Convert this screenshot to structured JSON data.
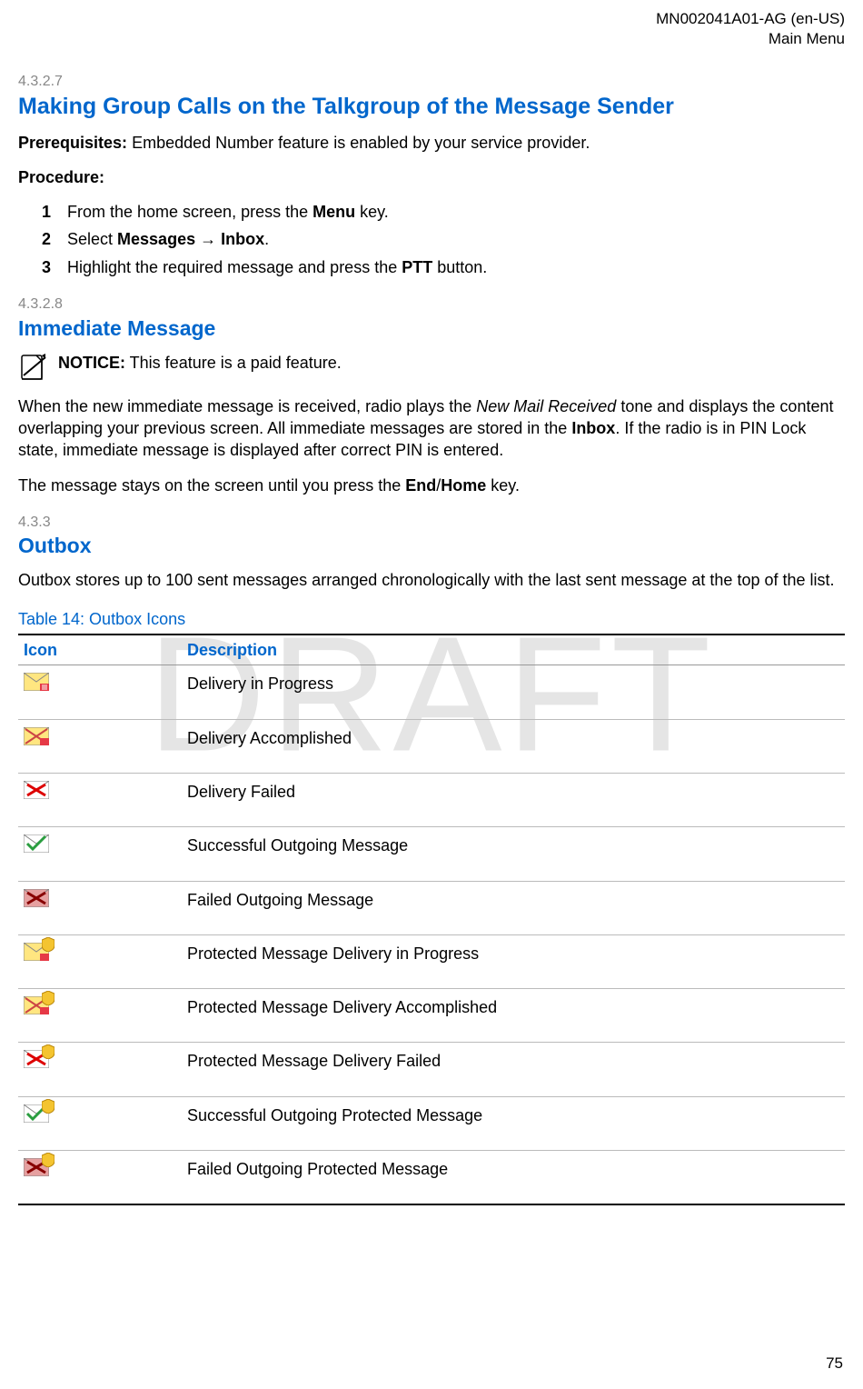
{
  "header": {
    "doc_id": "MN002041A01-AG (en-US)",
    "section": "Main Menu"
  },
  "watermark": "DRAFT",
  "s1": {
    "num": "4.3.2.7",
    "title": "Making Group Calls on the Talkgroup of the Message Sender",
    "prereq_label": "Prerequisites:",
    "prereq_text": " Embedded Number feature is enabled by your service provider.",
    "proc_label": "Procedure:",
    "steps": [
      {
        "n": "1",
        "pre": "From the home screen, press the ",
        "bold": "Menu",
        "post": " key."
      },
      {
        "n": "2",
        "pre": "Select ",
        "bold": "Messages",
        "mid": " → ",
        "bold2": "Inbox",
        "post": "."
      },
      {
        "n": "3",
        "pre": "Highlight the required message and press the ",
        "bold": "PTT",
        "post": " button."
      }
    ]
  },
  "s2": {
    "num": "4.3.2.8",
    "title": "Immediate Message",
    "notice_label": "NOTICE:",
    "notice_text": " This feature is a paid feature.",
    "p1a": "When the new immediate message is received, radio plays the ",
    "p1_it": "New Mail Received",
    "p1b": " tone and displays the content overlapping your previous screen. All immediate messages are stored in the ",
    "p1_bold": "Inbox",
    "p1c": ". If the radio is in PIN Lock state, immediate message is displayed after correct PIN is entered.",
    "p2a": "The message stays on the screen until you press the ",
    "p2_bold1": "End",
    "p2_mid": "/",
    "p2_bold2": "Home",
    "p2b": " key."
  },
  "s3": {
    "num": "4.3.3",
    "title": "Outbox",
    "p1": "Outbox stores up to 100 sent messages arranged chronologically with the last sent message at the top of the list.",
    "table_title": "Table 14: Outbox Icons",
    "th_icon": "Icon",
    "th_desc": "Description",
    "rows": [
      {
        "desc": "Delivery in Progress"
      },
      {
        "desc": "Delivery Accomplished"
      },
      {
        "desc": "Delivery Failed"
      },
      {
        "desc": "Successful Outgoing Message"
      },
      {
        "desc": "Failed Outgoing Message"
      },
      {
        "desc": "Protected Message Delivery in Progress"
      },
      {
        "desc": "Protected Message Delivery Accomplished"
      },
      {
        "desc": "Protected Message Delivery Failed"
      },
      {
        "desc": "Successful Outgoing Protected Message"
      },
      {
        "desc": "Failed Outgoing Protected Message"
      }
    ]
  },
  "page_number": "75"
}
